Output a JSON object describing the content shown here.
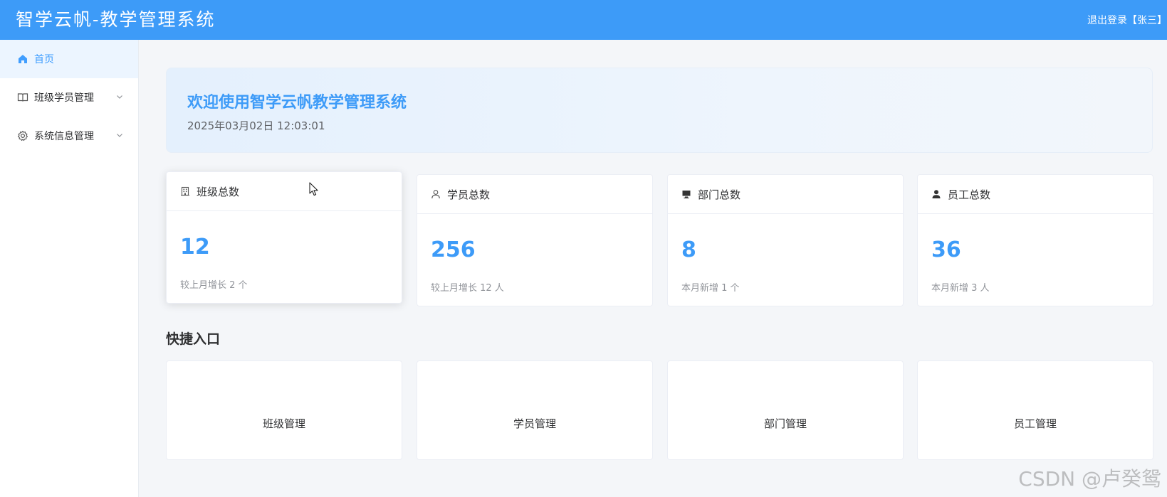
{
  "header": {
    "title": "智学云帆-教学管理系统",
    "logout": "退出登录【张三】"
  },
  "sidebar": {
    "items": [
      {
        "label": "首页",
        "icon": "home-icon",
        "active": true
      },
      {
        "label": "班级学员管理",
        "icon": "book-icon",
        "active": false
      },
      {
        "label": "系统信息管理",
        "icon": "gear-icon",
        "active": false
      }
    ]
  },
  "banner": {
    "welcome": "欢迎使用智学云帆教学管理系统",
    "datetime": "2025年03月02日 12:03:01"
  },
  "stats": [
    {
      "title": "班级总数",
      "icon": "office-building-icon",
      "value": "12",
      "sub": "较上月增长 2 个"
    },
    {
      "title": "学员总数",
      "icon": "user-icon",
      "value": "256",
      "sub": "较上月增长 12 人"
    },
    {
      "title": "部门总数",
      "icon": "monitor-icon",
      "value": "8",
      "sub": "本月新增 1 个"
    },
    {
      "title": "员工总数",
      "icon": "user-filled-icon",
      "value": "36",
      "sub": "本月新增 3 人"
    }
  ],
  "quick": {
    "title": "快捷入口",
    "items": [
      "班级管理",
      "学员管理",
      "部门管理",
      "员工管理"
    ]
  },
  "watermark": "CSDN @卢癸鸳",
  "colors": {
    "header_bg": "#3d9bf8",
    "accent": "#3d9bf8",
    "active_menu_bg": "#ecf5ff",
    "page_bg": "#f4f6f9"
  }
}
